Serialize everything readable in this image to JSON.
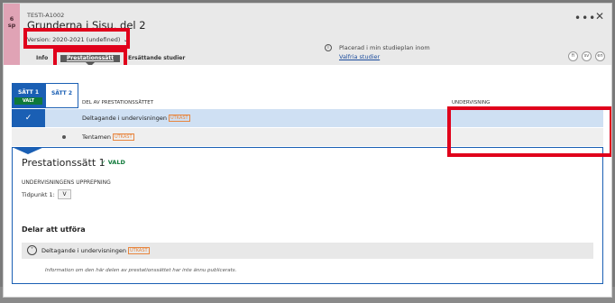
{
  "course": {
    "credits_value": "6",
    "credits_unit": "sp",
    "code": "TESTI-A1002",
    "title": "Grunderna i Sisu, del 2",
    "version": "Version: 2020-2021 (undefined)",
    "version_chevron": "chevron-down-icon"
  },
  "header_actions": {
    "more": "•••",
    "close": "✕"
  },
  "tabs": [
    {
      "label": "Info"
    },
    {
      "label": "Prestationssätt",
      "active": true
    },
    {
      "label": "Ersättande studier"
    }
  ],
  "plan": {
    "text": "Placerad i min studieplan inom",
    "link": "Valfria studier"
  },
  "languages": [
    "fi",
    "sv",
    "en"
  ],
  "sett_tabs": [
    {
      "label": "SÄTT 1",
      "badge": "VALT"
    },
    {
      "label": "SÄTT 2"
    }
  ],
  "columns": {
    "part": "DEL AV PRESTATIONSSÄTTET",
    "teaching": "UNDERVISNING"
  },
  "rows": [
    {
      "label": "Deltagande i undervisningen",
      "badge": "UTKAST",
      "mark": "✓"
    },
    {
      "label": "Tentamen",
      "badge": "UTKAST"
    }
  ],
  "panel": {
    "title": "Prestationssätt 1",
    "valt": "✓ VALD",
    "sub": "UNDERVISNINGENS UPPREPNING",
    "tid_label": "Tidpunkt 1:",
    "tid_value": "V",
    "delar": "Delar att utföra",
    "bar_label": "Deltagande i undervisningen",
    "bar_badge": "UTKAST",
    "bar_icon": "˅",
    "info": "Information om den här delen av prestationssättet har inte ännu publicerats."
  },
  "colors": {
    "accent": "#1a5fb4",
    "selected_green": "#0f7a3a",
    "draft_orange": "#e8853d",
    "credits_bg": "#e0a3b5",
    "highlight_red": "#e0001b"
  }
}
